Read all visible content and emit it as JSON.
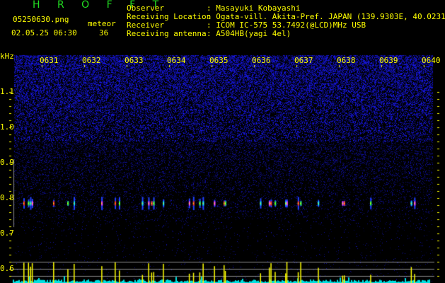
{
  "header": {
    "app_title": "H R O F F T",
    "filename": "05250630.png",
    "datetime": "02.05.25 06:30",
    "meteor_label": "meteor",
    "meteor_count": "36",
    "info": [
      {
        "label": "Observer",
        "value": ": Masayuki Kobayashi"
      },
      {
        "label": "Receiving Location",
        "value": ": Ogata-vill. Akita-Pref. JAPAN (139.9303E, 40.0231N)"
      },
      {
        "label": "Receiver",
        "value": ": ICOM IC-575 53.7492(@LCD)MHz USB"
      },
      {
        "label": "Receiving antenna",
        "value": ": A504HB(yagi 4el)"
      }
    ]
  },
  "colors": {
    "text": "#ffff00",
    "title": "#22dd22",
    "noise": "#1a1aff",
    "count_bar": "#00e0e0",
    "meteor_bar": "#ffff00"
  },
  "chart_data": {
    "type": "heatmap",
    "title": "HROFFT spectrogram",
    "ylabel": "kHz",
    "yticks": [
      "1.1",
      "1.0",
      "0.9",
      "0.8",
      "0.7",
      "0.6"
    ],
    "ylim": [
      0.56,
      1.2
    ],
    "xticks": [
      "0631",
      "0632",
      "0633",
      "0634",
      "0635",
      "0636",
      "0637",
      "0638",
      "0639",
      "0640"
    ],
    "xlim_minutes": [
      0,
      10
    ],
    "meteor_echo_freq_khz": 0.785,
    "meteor_times_min": [
      0.22,
      0.33,
      0.38,
      0.42,
      0.93,
      1.27,
      1.42,
      2.08,
      2.4,
      2.5,
      3.05,
      3.2,
      3.27,
      3.32,
      3.55,
      4.17,
      4.27,
      4.42,
      4.5,
      4.77,
      5.0,
      5.03,
      5.87,
      6.08,
      6.12,
      6.22,
      6.47,
      6.5,
      6.77,
      6.83,
      7.25,
      7.83,
      7.87,
      8.5,
      9.47,
      9.55
    ]
  }
}
